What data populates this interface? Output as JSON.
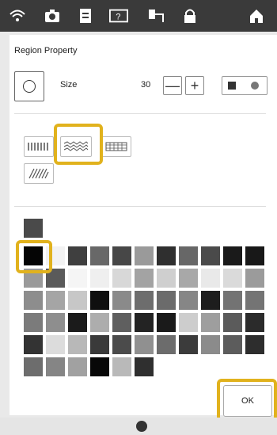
{
  "header": {
    "icons": [
      "wifi-icon",
      "camera-icon",
      "document-icon",
      "help-icon",
      "thread-icon",
      "lock-icon",
      "home-icon"
    ]
  },
  "dialog": {
    "title": "Region Property",
    "size_label": "Size",
    "size_value": "30",
    "minus_label": "—",
    "plus_label": "+",
    "ok_label": "OK"
  },
  "stitch_types": [
    "running-stitch-icon",
    "fill-stitch-icon",
    "grid-stitch-icon",
    "satin-stitch-icon"
  ],
  "palette": {
    "selected_color": "#050505",
    "rows": [
      [
        "#111111",
        "#f2f2f2",
        "#3f3f3f",
        "#686868",
        "#474747",
        "#9a9a9a",
        "#2f2f2f",
        "#676767",
        "#4a4a4a",
        "#1a1a1a",
        "#181818"
      ],
      [
        "#9a9a9a",
        "#5a5a5a",
        "#f5f5f5",
        "#efefef",
        "#d8d8d8",
        "#a3a3a3",
        "#cfcfcf",
        "#a8a8a8",
        "#e9e9e9",
        "#dadada",
        "#9b9b9b"
      ],
      [
        "#8d8d8d",
        "#a5a5a5",
        "#c7c7c7",
        "#0f0f0f",
        "#8a8a8a",
        "#6d6d6d",
        "#6b6b6b",
        "#868686",
        "#1d1d1d",
        "#737373",
        "#747474"
      ],
      [
        "#7b7b7b",
        "#8e8e8e",
        "#1b1b1b",
        "#adadad",
        "#5f5f5f",
        "#232323",
        "#1a1a1a",
        "#cdcdcd",
        "#9e9e9e",
        "#5b5b5b",
        "#2b2b2b"
      ],
      [
        "#333333",
        "#dcdcdc",
        "#b8b8b8",
        "#3a3a3a",
        "#4b4b4b",
        "#909090",
        "#6c6c6c",
        "#3b3b3b",
        "#8b8b8b",
        "#5c5c5c",
        "#2d2d2d"
      ],
      [
        "#6d6d6d",
        "#858585",
        "#a1a1a1",
        "#080808",
        "#b9b9b9",
        "#2f2f2f"
      ]
    ]
  }
}
